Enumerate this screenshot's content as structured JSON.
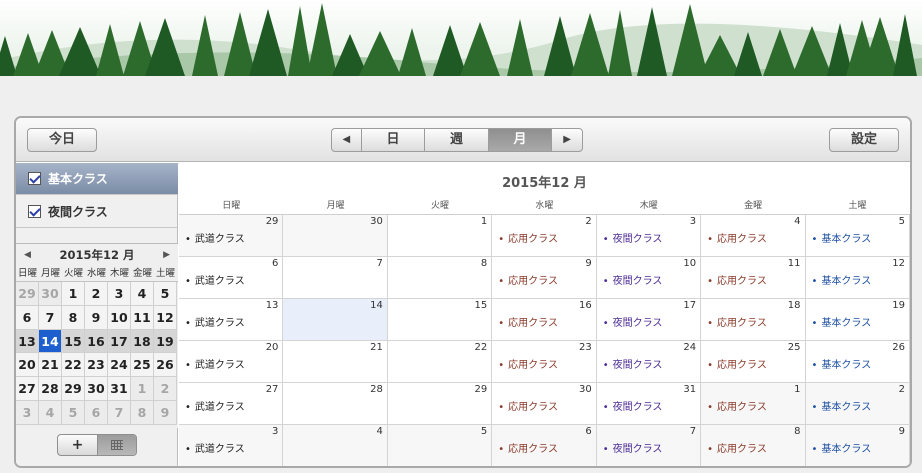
{
  "toolbar": {
    "today": "今日",
    "prev": "◀",
    "next": "▶",
    "views": [
      "日",
      "週",
      "月"
    ],
    "active_view": "月",
    "settings": "設定"
  },
  "sidebar": {
    "calendars": [
      {
        "label": "基本クラス",
        "checked": true,
        "selected": true
      },
      {
        "label": "夜間クラス",
        "checked": true,
        "selected": false
      }
    ],
    "add_label": "+"
  },
  "mini": {
    "title": "2015年12 月",
    "prev": "◀",
    "next": "▶",
    "dow": [
      "日曜",
      "月曜",
      "火曜",
      "水曜",
      "木曜",
      "金曜",
      "土曜"
    ],
    "weeks": [
      [
        29,
        30,
        1,
        2,
        3,
        4,
        5
      ],
      [
        6,
        7,
        8,
        9,
        10,
        11,
        12
      ],
      [
        13,
        14,
        15,
        16,
        17,
        18,
        19
      ],
      [
        20,
        21,
        22,
        23,
        24,
        25,
        26
      ],
      [
        27,
        28,
        29,
        30,
        31,
        1,
        2
      ],
      [
        3,
        4,
        5,
        6,
        7,
        8,
        9
      ]
    ]
  },
  "main": {
    "title": "2015年12 月",
    "dow": [
      "日曜",
      "月曜",
      "火曜",
      "水曜",
      "木曜",
      "金曜",
      "土曜"
    ],
    "weeks": [
      [
        29,
        30,
        1,
        2,
        3,
        4,
        5
      ],
      [
        6,
        7,
        8,
        9,
        10,
        11,
        12
      ],
      [
        13,
        14,
        15,
        16,
        17,
        18,
        19
      ],
      [
        20,
        21,
        22,
        23,
        24,
        25,
        26
      ],
      [
        27,
        28,
        29,
        30,
        31,
        1,
        2
      ],
      [
        3,
        4,
        5,
        6,
        7,
        8,
        9
      ]
    ],
    "week_events": [
      "武道クラス",
      "",
      "",
      "応用クラス",
      "夜間クラス",
      "応用クラス",
      "基本クラス"
    ]
  },
  "colors": {
    "today": "#1d5fcf",
    "basic": "#1d4fa3",
    "night": "#4c2c96",
    "applied": "#8a3a2a"
  }
}
